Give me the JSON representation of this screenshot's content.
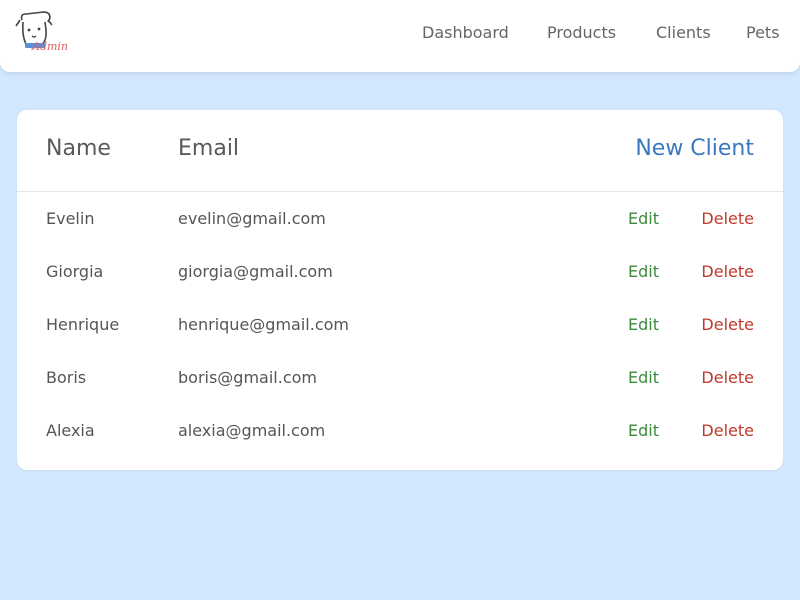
{
  "app": {
    "logo_icon": "dog-admin-logo-icon",
    "logo_text": "Admin"
  },
  "nav": {
    "items": [
      {
        "label": "Dashboard"
      },
      {
        "label": "Products"
      },
      {
        "label": "Clients"
      },
      {
        "label": "Pets"
      }
    ]
  },
  "table": {
    "headers": {
      "name": "Name",
      "email": "Email"
    },
    "new_button_label": "New Client",
    "edit_label": "Edit",
    "delete_label": "Delete",
    "rows": [
      {
        "name": "Evelin",
        "email": "evelin@gmail.com"
      },
      {
        "name": "Giorgia",
        "email": "giorgia@gmail.com"
      },
      {
        "name": "Henrique",
        "email": "henrique@gmail.com"
      },
      {
        "name": "Boris",
        "email": "boris@gmail.com"
      },
      {
        "name": "Alexia",
        "email": "alexia@gmail.com"
      }
    ]
  },
  "colors": {
    "background": "#d3e7fd",
    "accent": "#3b78c2",
    "edit": "#3c8a3c",
    "delete": "#c0392b"
  }
}
